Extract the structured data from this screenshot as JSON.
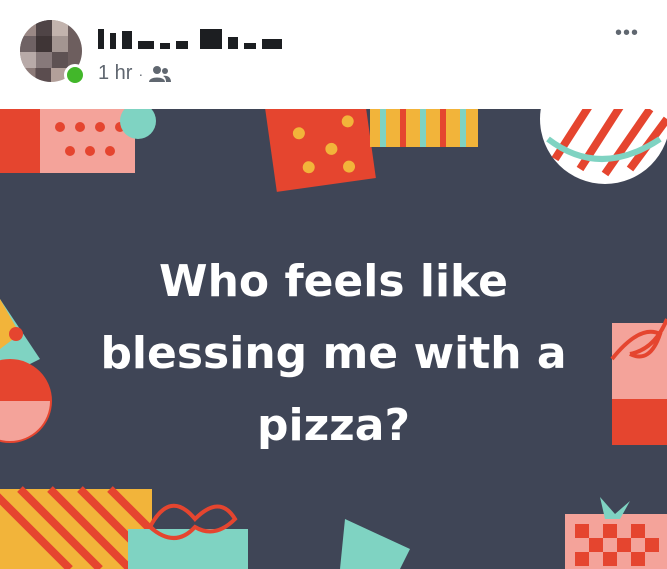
{
  "post_header": {
    "author_name": "",
    "time": "1 hr",
    "separator": "·",
    "audience_icon": "friends-icon",
    "more_label": "•••"
  },
  "post_body": {
    "lines": [
      "Who feels like",
      "blessing me with a",
      "pizza?"
    ],
    "background_color": "#3f4556",
    "text_color": "#ffffff"
  },
  "colors": {
    "online": "#42b72a",
    "meta_text": "#606770",
    "red": "#e5452f",
    "pink": "#f4a39a",
    "yellow": "#f2b43a",
    "teal": "#7fd3c2"
  }
}
